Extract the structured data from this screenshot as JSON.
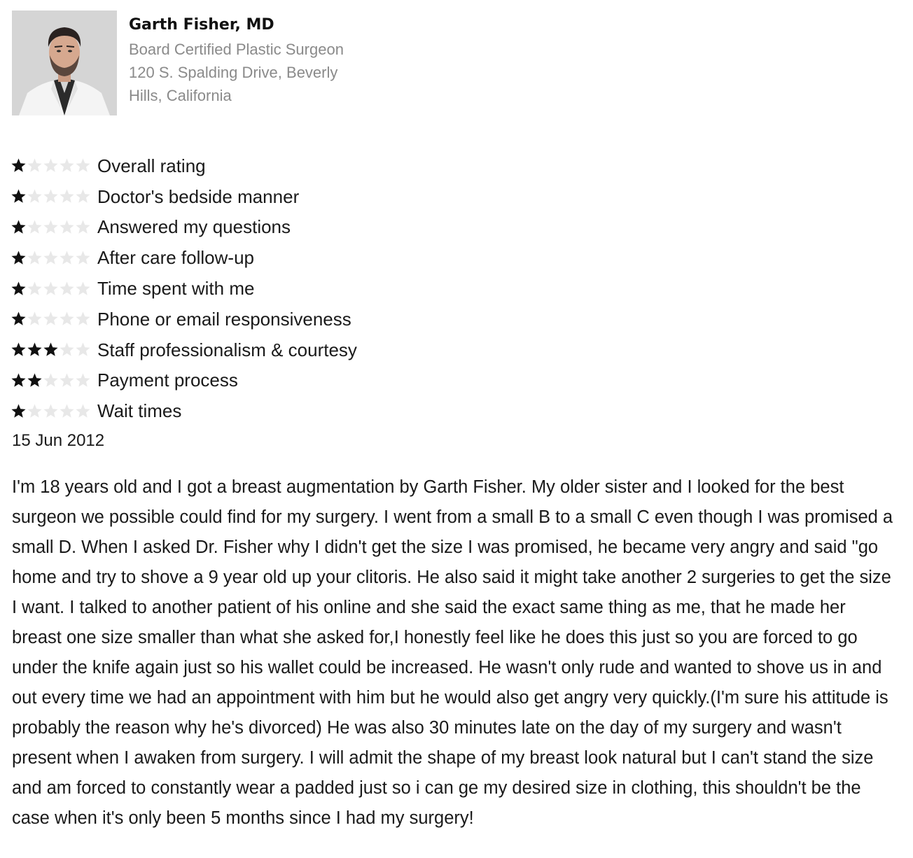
{
  "doctor": {
    "name": "Garth Fisher, MD",
    "title": "Board Certified Plastic Surgeon",
    "address": "120 S. Spalding Drive, Beverly Hills, California"
  },
  "ratings": [
    {
      "label": "Overall rating",
      "stars": 1,
      "max": 5
    },
    {
      "label": "Doctor's bedside manner",
      "stars": 1,
      "max": 5
    },
    {
      "label": "Answered my questions",
      "stars": 1,
      "max": 5
    },
    {
      "label": "After care follow-up",
      "stars": 1,
      "max": 5
    },
    {
      "label": "Time spent with me",
      "stars": 1,
      "max": 5
    },
    {
      "label": "Phone or email responsiveness",
      "stars": 1,
      "max": 5
    },
    {
      "label": "Staff professionalism & courtesy",
      "stars": 3,
      "max": 5
    },
    {
      "label": "Payment process",
      "stars": 2,
      "max": 5
    },
    {
      "label": "Wait times",
      "stars": 1,
      "max": 5
    }
  ],
  "review": {
    "date": "15 Jun 2012",
    "text": "I'm 18 years old and I got a breast augmentation by Garth Fisher. My older sister and I looked for the best surgeon we possible could find for my surgery. I went from a small B to a small C even though I was promised a small D. When I asked Dr. Fisher why I didn't get the size I was promised, he became very angry and said \"go home and try to shove a 9 year old up your clitoris. He also said it might take another 2 surgeries to get the size I want. I talked to another patient of his online and she said the exact same thing as me, that he made her breast one size smaller than what she asked for,I honestly feel like he does this just so you are forced to go under the knife again just so his wallet could be increased. He wasn't only rude and wanted to shove us in and out every time we had an appointment with him but he would also get angry very quickly.(I'm sure his attitude is probably the reason why he's divorced) He was also 30 minutes late on the day of my surgery and wasn't present when I awaken from surgery. I will admit the shape of my breast look natural but I can't stand the size and am forced to constantly wear a padded just so i can ge my desired size in clothing, this shouldn't be the case when it's only been 5 months since I had my surgery!"
  },
  "colors": {
    "star_filled": "#111111",
    "star_empty": "#e8e8e8",
    "meta_text": "#8a8a8a"
  }
}
